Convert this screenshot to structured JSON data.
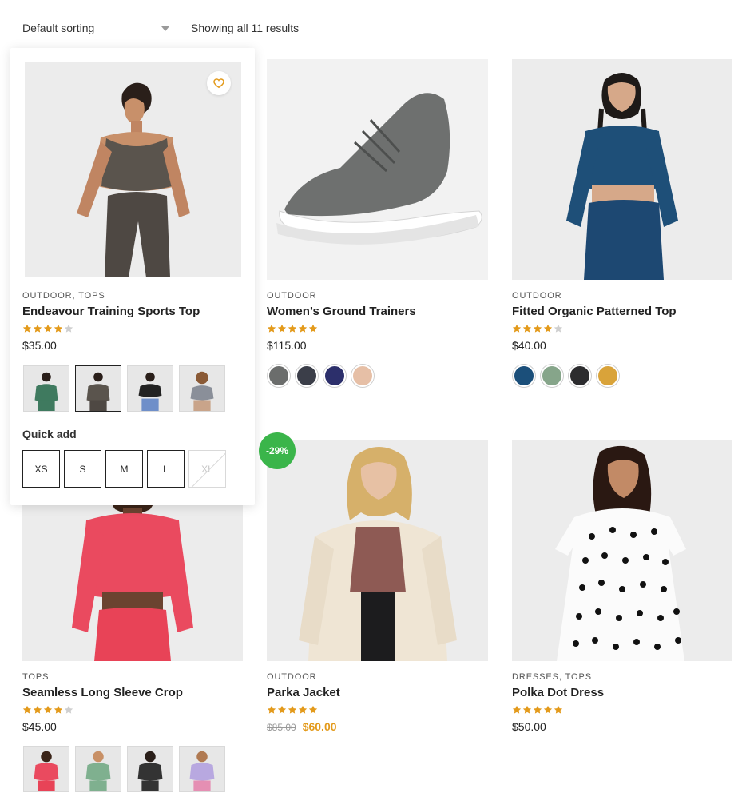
{
  "toolbar": {
    "sort_label": "Default sorting",
    "results_text": "Showing all 11 results"
  },
  "products": [
    {
      "categories": "OUTDOOR, TOPS",
      "title": "Endeavour Training Sports Top",
      "rating": 4,
      "price": "$35.00",
      "thumbs": [
        "green",
        "charcoal",
        "blue",
        "grey"
      ],
      "quick_add_label": "Quick add",
      "sizes": [
        "XS",
        "S",
        "M",
        "L",
        "XL"
      ],
      "unavailable_sizes": [
        "XL"
      ]
    },
    {
      "categories": "OUTDOOR",
      "title": "Women’s Ground Trainers",
      "rating": 5,
      "price": "$115.00",
      "swatches": [
        "#6b6d6c",
        "#3b3e49",
        "#2c2f6b",
        "#e6bfa6"
      ]
    },
    {
      "categories": "OUTDOOR",
      "title": "Fitted Organic Patterned Top",
      "rating": 4,
      "price": "$40.00",
      "swatches": [
        "#1b4f7a",
        "#86a58a",
        "#2c2c2e",
        "#d9a33a"
      ]
    },
    {
      "categories": "TOPS",
      "title": "Seamless Long Sleeve Crop",
      "rating": 4,
      "price": "$45.00",
      "thumbs": [
        "red",
        "green",
        "black",
        "lilac"
      ]
    },
    {
      "categories": "OUTDOOR",
      "title": "Parka Jacket",
      "rating": 5,
      "badge": "-29%",
      "old_price": "$85.00",
      "sale_price": "$60.00"
    },
    {
      "categories": "DRESSES, TOPS",
      "title": "Polka Dot Dress",
      "rating": 5,
      "price": "$50.00"
    }
  ],
  "colors": {
    "star": "#e39a1b",
    "star_empty": "#cfcfcf",
    "sale": "#e39a1b",
    "badge": "#3ab54a"
  }
}
